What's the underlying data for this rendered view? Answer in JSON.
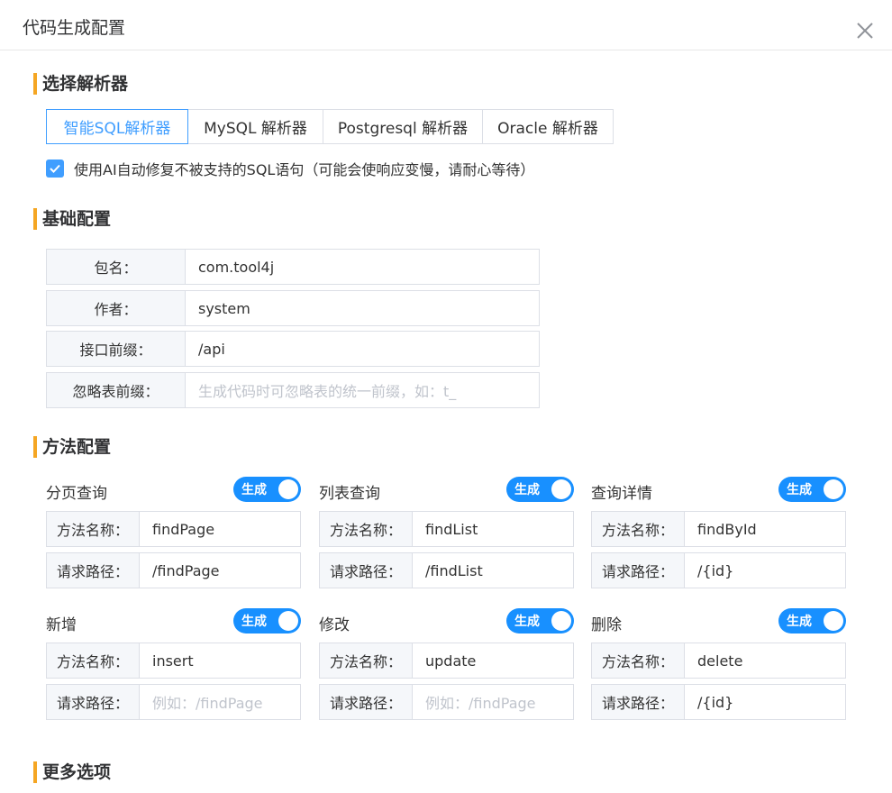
{
  "dialog": {
    "title": "代码生成配置"
  },
  "sections": {
    "parser": "选择解析器",
    "basic": "基础配置",
    "methods": "方法配置",
    "more": "更多选项"
  },
  "parsers": [
    {
      "label": "智能SQL解析器",
      "active": true
    },
    {
      "label": "MySQL 解析器",
      "active": false
    },
    {
      "label": "Postgresql 解析器",
      "active": false
    },
    {
      "label": "Oracle 解析器",
      "active": false
    }
  ],
  "ai_fix": {
    "label": "使用AI自动修复不被支持的SQL语句（可能会使响应变慢，请耐心等待）",
    "checked": true
  },
  "basic": {
    "package_label": "包名：",
    "package_value": "com.tool4j",
    "author_label": "作者：",
    "author_value": "system",
    "prefix_label": "接口前缀：",
    "prefix_value": "/api",
    "ignore_label": "忽略表前缀：",
    "ignore_placeholder": "生成代码时可忽略表的统一前缀，如：t_"
  },
  "method_labels": {
    "name": "方法名称：",
    "path": "请求路径：",
    "toggle": "生成"
  },
  "methods": [
    {
      "title": "分页查询",
      "name": "findPage",
      "path": "/findPage",
      "path_placeholder": ""
    },
    {
      "title": "列表查询",
      "name": "findList",
      "path": "/findList",
      "path_placeholder": ""
    },
    {
      "title": "查询详情",
      "name": "findById",
      "path": "/{id}",
      "path_placeholder": ""
    },
    {
      "title": "新增",
      "name": "insert",
      "path": "",
      "path_placeholder": "例如：/findPage"
    },
    {
      "title": "修改",
      "name": "update",
      "path": "",
      "path_placeholder": "例如：/findPage"
    },
    {
      "title": "删除",
      "name": "delete",
      "path": "/{id}",
      "path_placeholder": ""
    }
  ],
  "colors": {
    "accent": "#409eff",
    "switch": "#1890ff",
    "section_bar": "#f5a623"
  }
}
